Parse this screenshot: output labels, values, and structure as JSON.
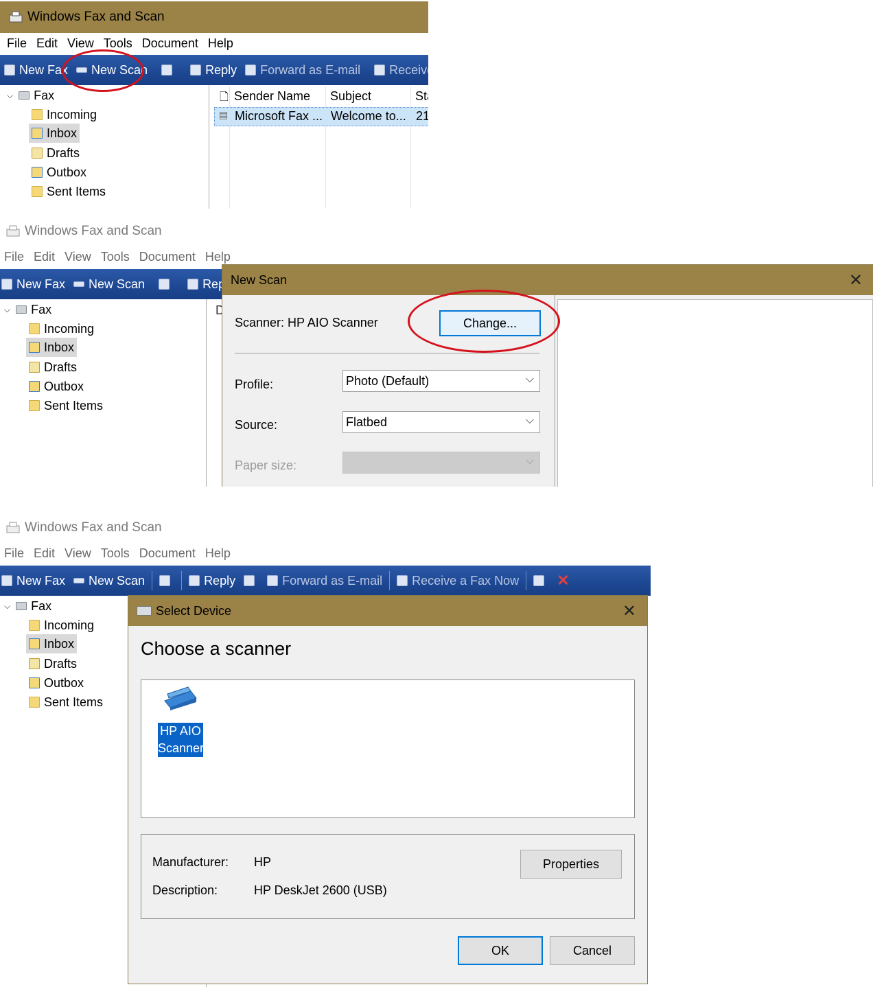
{
  "app_title": "Windows Fax and Scan",
  "menu": [
    "File",
    "Edit",
    "View",
    "Tools",
    "Document",
    "Help"
  ],
  "toolbar": {
    "new_fax": "New Fax",
    "new_scan": "New Scan",
    "reply": "Reply",
    "forward_email": "Forward as E-mail",
    "receive_partial": "Receive a",
    "receive_full": "Receive a Fax Now"
  },
  "tree": {
    "root": "Fax",
    "items": [
      "Incoming",
      "Inbox",
      "Drafts",
      "Outbox",
      "Sent Items"
    ],
    "selected": "Inbox"
  },
  "list": {
    "columns": [
      "Sender Name",
      "Subject",
      "Sta"
    ],
    "rows": [
      [
        "Microsoft Fax ...",
        "Welcome to...",
        "21"
      ]
    ],
    "col_d": "D"
  },
  "new_scan_dialog": {
    "title": "New Scan",
    "scanner_label": "Scanner: HP AIO Scanner",
    "change_button": "Change...",
    "profile_label": "Profile:",
    "profile_value": "Photo (Default)",
    "source_label": "Source:",
    "source_value": "Flatbed",
    "paper_size_label": "Paper size:",
    "paper_size_value": ""
  },
  "select_device_dialog": {
    "title": "Select Device",
    "heading": "Choose a scanner",
    "device_line1": "HP AIO",
    "device_line2": "Scanner",
    "manufacturer_label": "Manufacturer:",
    "manufacturer_value": "HP",
    "description_label": "Description:",
    "description_value": "HP DeskJet 2600 (USB)",
    "properties_button": "Properties",
    "ok_button": "OK",
    "cancel_button": "Cancel"
  },
  "colors": {
    "title_active": "#9b8348",
    "toolbar_blue": "#1d4792",
    "highlight_ring": "#d4121c",
    "selection_blue": "#0a64c8"
  },
  "icons": [
    "fax-app-icon",
    "new-fax-icon",
    "new-scan-icon",
    "reply-icon",
    "forward-icon",
    "receive-icon",
    "printer-icon",
    "delete-icon",
    "folder-icon",
    "scanner-icon"
  ]
}
